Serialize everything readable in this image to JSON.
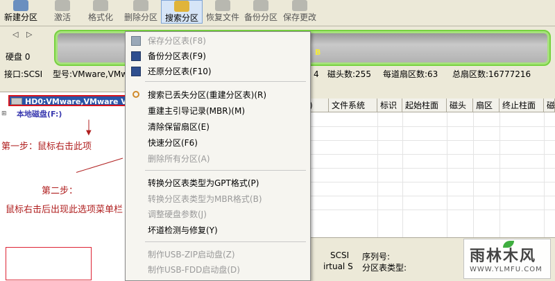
{
  "toolbar": {
    "buttons": [
      {
        "label": "新建分区",
        "icon": "new-partition-icon",
        "state": "normal"
      },
      {
        "label": "激活",
        "icon": "activate-icon",
        "state": "disabled"
      },
      {
        "label": "格式化",
        "icon": "format-icon",
        "state": "disabled"
      },
      {
        "label": "删除分区",
        "icon": "delete-partition-icon",
        "state": "disabled"
      },
      {
        "label": "搜索分区",
        "icon": "search-partition-icon",
        "state": "active"
      },
      {
        "label": "恢复文件",
        "icon": "recover-file-icon",
        "state": "disabled"
      },
      {
        "label": "备份分区",
        "icon": "backup-partition-icon",
        "state": "disabled"
      },
      {
        "label": "保存更改",
        "icon": "save-changes-icon",
        "state": "disabled"
      }
    ]
  },
  "disk": {
    "nav": "◁ ▷",
    "label": "硬盘 0",
    "bar_text": "B",
    "info": {
      "interface": "接口:SCSI",
      "model": "型号:VMware,VMwa",
      "cyl_tail": "4",
      "heads": "磁头数:255",
      "sectors_per_track": "每道扇区数:63",
      "total_sectors": "总扇区数:16777216"
    }
  },
  "tree": {
    "selected": "HD0:VMware,VMware V",
    "sub": "本地磁盘(F:)"
  },
  "annotations": {
    "step1": "第一步：鼠标右击此项",
    "step2_title": "第二步：",
    "step2_desc": "鼠标右击后出现此选项菜单栏"
  },
  "table": {
    "columns": [
      ")",
      "文件系统",
      "标识",
      "起始柱面",
      "磁头",
      "扇区",
      "终止柱面",
      "磁"
    ]
  },
  "bottom": {
    "scsi": "SCSI",
    "virtual": "irtual S",
    "serial_label": "序列号:",
    "table_type_label": "分区表类型:"
  },
  "watermark": {
    "main": "雨林木风",
    "sub": "WWW.YLMFU.COM"
  },
  "menu": {
    "items": [
      {
        "label": "保存分区表(F8)",
        "enabled": false,
        "icon": "save-table-icon"
      },
      {
        "label": "备份分区表(F9)",
        "enabled": true,
        "icon": "backup-table-icon"
      },
      {
        "label": "还原分区表(F10)",
        "enabled": true,
        "icon": "restore-table-icon"
      },
      {
        "label": "搜索已丢失分区(重建分区表)(R)",
        "enabled": true,
        "icon": "search-lost-partition-icon"
      },
      {
        "label": "重建主引导记录(MBR)(M)",
        "enabled": true,
        "icon": ""
      },
      {
        "label": "清除保留扇区(E)",
        "enabled": true,
        "icon": ""
      },
      {
        "label": "快速分区(F6)",
        "enabled": true,
        "icon": ""
      },
      {
        "label": "删除所有分区(A)",
        "enabled": false,
        "icon": ""
      },
      {
        "label": "转换分区表类型为GPT格式(P)",
        "enabled": true,
        "icon": ""
      },
      {
        "label": "转换分区表类型为MBR格式(B)",
        "enabled": false,
        "icon": ""
      },
      {
        "label": "调整硬盘参数(J)",
        "enabled": false,
        "icon": ""
      },
      {
        "label": "坏道检测与修复(Y)",
        "enabled": true,
        "icon": ""
      },
      {
        "label": "制作USB-ZIP启动盘(Z)",
        "enabled": false,
        "icon": ""
      },
      {
        "label": "制作USB-FDD启动盘(D)",
        "enabled": false,
        "icon": ""
      }
    ]
  }
}
